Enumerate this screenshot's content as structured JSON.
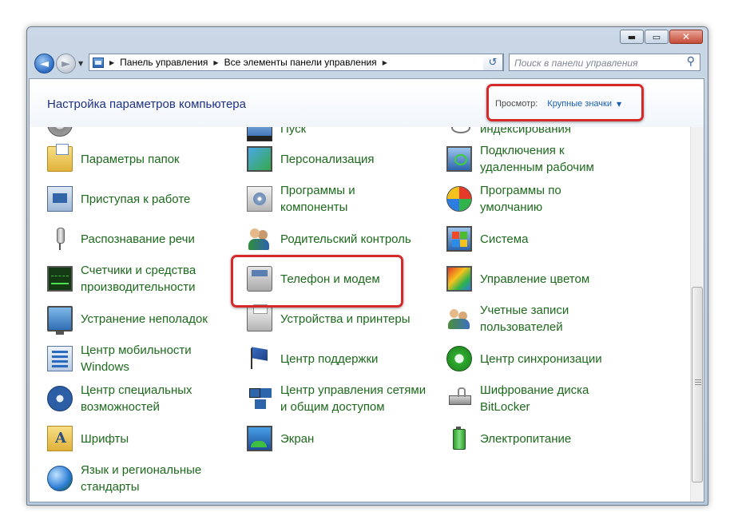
{
  "window": {
    "buttons": {
      "minimize": "▬",
      "maximize": "▭",
      "close": "✕"
    }
  },
  "nav": {
    "back_glyph": "◄",
    "forward_glyph": "►",
    "history_glyph": "▼",
    "breadcrumbs": [
      "Панель управления",
      "Все элементы панели управления"
    ],
    "crumb_separator": "▶",
    "refresh_glyph": "↺",
    "search_placeholder": "Поиск в панели управления",
    "search_glyph": "⚲"
  },
  "header": {
    "title": "Настройка параметров компьютера",
    "view_label": "Просмотр:",
    "view_value": "Крупные значки",
    "view_arrow": "▼"
  },
  "items": {
    "col1": [
      {
        "label": "",
        "icon": "gear-icon"
      },
      {
        "label": "Параметры папок",
        "icon": "folder-options-icon"
      },
      {
        "label": "Приступая к работе",
        "icon": "getting-started-icon"
      },
      {
        "label": "Распознавание речи",
        "icon": "microphone-icon"
      },
      {
        "label": "Счетчики и средства\nпроизводительности",
        "icon": "performance-icon"
      },
      {
        "label": "Устранение неполадок",
        "icon": "troubleshooting-icon"
      },
      {
        "label": "Центр мобильности\nWindows",
        "icon": "mobility-center-icon"
      },
      {
        "label": "Центр специальных\nвозможностей",
        "icon": "accessibility-icon"
      },
      {
        "label": "Шрифты",
        "icon": "fonts-icon"
      },
      {
        "label": "Язык и региональные\nстандарты",
        "icon": "globe-icon"
      }
    ],
    "col2": [
      {
        "label": "Пуск",
        "icon": "taskbar-icon"
      },
      {
        "label": "Персонализация",
        "icon": "personalization-icon"
      },
      {
        "label": "Программы и\nкомпоненты",
        "icon": "programs-icon"
      },
      {
        "label": "Родительский контроль",
        "icon": "parental-controls-icon"
      },
      {
        "label": "Телефон и модем",
        "icon": "phone-modem-icon"
      },
      {
        "label": "Устройства и принтеры",
        "icon": "printer-icon"
      },
      {
        "label": "Центр поддержки",
        "icon": "action-center-flag-icon"
      },
      {
        "label": "Центр управления сетями\nи общим доступом",
        "icon": "network-icon"
      },
      {
        "label": "Экран",
        "icon": "display-icon"
      }
    ],
    "col3": [
      {
        "label": "индексирования",
        "icon": "indexing-icon"
      },
      {
        "label": "Подключения к\nудаленным рабочим",
        "icon": "remote-desktop-icon"
      },
      {
        "label": "Программы по\nумолчанию",
        "icon": "default-programs-icon"
      },
      {
        "label": "Система",
        "icon": "system-icon"
      },
      {
        "label": "Управление цветом",
        "icon": "color-management-icon"
      },
      {
        "label": "Учетные записи\nпользователей",
        "icon": "user-accounts-icon"
      },
      {
        "label": "Центр синхронизации",
        "icon": "sync-center-icon"
      },
      {
        "label": "Шифрование диска\nBitLocker",
        "icon": "bitlocker-icon"
      },
      {
        "label": "Электропитание",
        "icon": "power-options-icon"
      }
    ]
  },
  "colors": {
    "link_green": "#1d6a1d",
    "header_blue": "#1e3287",
    "highlight_red": "#d62a2a"
  }
}
